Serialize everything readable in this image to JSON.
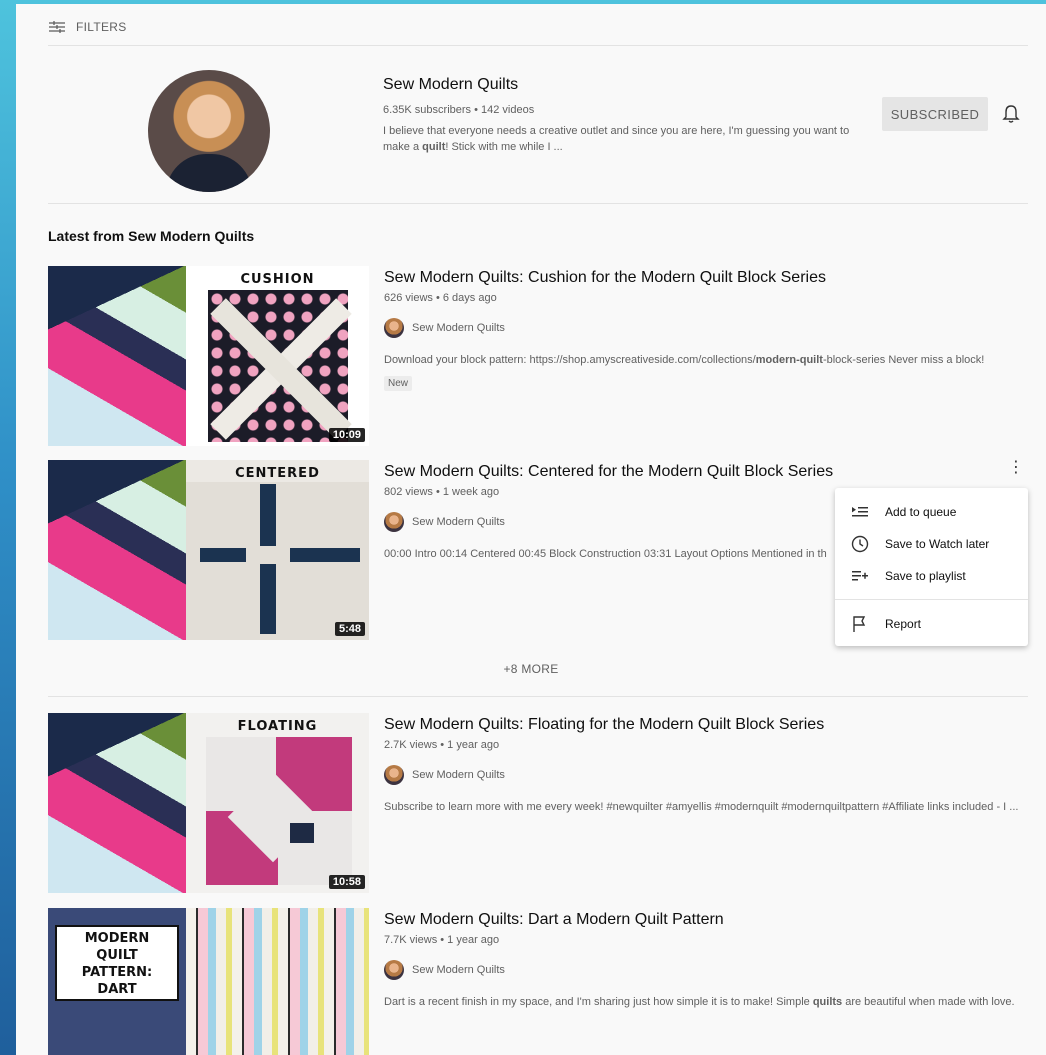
{
  "filters": {
    "label": "FILTERS",
    "icon": "filters-icon"
  },
  "channel": {
    "name": "Sew Modern Quilts",
    "meta": "6.35K subscribers • 142 videos",
    "description_before": "I believe that everyone needs a creative outlet and since you are here, I'm guessing you want to make a ",
    "description_bold": "quilt",
    "description_after": "! Stick with me while I ...",
    "subscribe_label": "SUBSCRIBED",
    "bell_icon": "bell-icon"
  },
  "section_title": "Latest from Sew Modern Quilts",
  "videos": [
    {
      "title": "Sew Modern Quilts: Cushion for the Modern Quilt Block Series",
      "meta": "626 views • 6 days ago",
      "channel": "Sew Modern Quilts",
      "desc_before": "Download your block pattern: https://shop.amyscreativeside.com/collections/",
      "desc_bold": "modern-quilt",
      "desc_after": "-block-series Never miss a block!",
      "badge": "New",
      "thumb_label": "CUSHION",
      "duration": "10:09"
    },
    {
      "title": "Sew Modern Quilts: Centered for the Modern Quilt Block Series",
      "meta": "802 views • 1 week ago",
      "channel": "Sew Modern Quilts",
      "desc": "00:00 Intro 00:14 Centered 00:45 Block Construction 03:31 Layout Options Mentioned in th",
      "thumb_label": "CENTERED",
      "duration": "5:48"
    },
    {
      "title": "Sew Modern Quilts: Floating for the Modern Quilt Block Series",
      "meta": "2.7K views • 1 year ago",
      "channel": "Sew Modern Quilts",
      "desc": "Subscribe to learn more with me every week! #newquilter #amyellis #modernquilt #modernquiltpattern #Affiliate links included - I ...",
      "thumb_label": "FLOATING",
      "duration": "10:58"
    },
    {
      "title": "Sew Modern Quilts: Dart a Modern Quilt Pattern",
      "meta": "7.7K views • 1 year ago",
      "channel": "Sew Modern Quilts",
      "desc_before": "Dart is a recent finish in my space, and I'm sharing just how simple it is to make! Simple ",
      "desc_bold": "quilts",
      "desc_after": " are beautiful when made with love.",
      "thumb_card": [
        "MODERN",
        "QUILT",
        "PATTERN:",
        "DART"
      ]
    }
  ],
  "more_label": "+8 MORE",
  "menu": {
    "items": [
      {
        "label": "Add to queue",
        "icon": "add-to-queue-icon"
      },
      {
        "label": "Save to Watch later",
        "icon": "clock-icon"
      },
      {
        "label": "Save to playlist",
        "icon": "playlist-add-icon"
      },
      {
        "label": "Report",
        "icon": "flag-icon"
      }
    ]
  },
  "colors": {
    "panel": "#f9f9f9",
    "text": "#0f0f0f",
    "secondary": "#606060",
    "subscribed_bg": "#e5e5e5"
  }
}
